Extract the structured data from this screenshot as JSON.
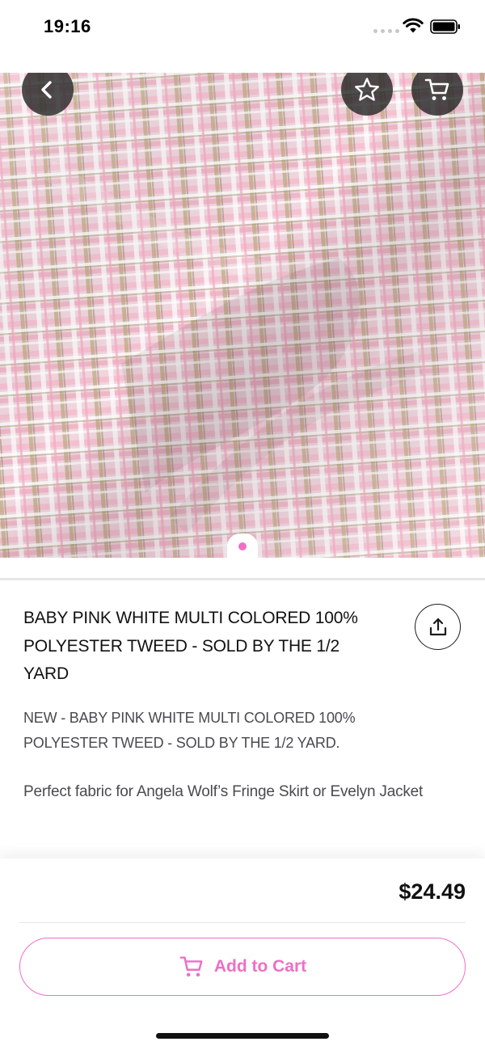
{
  "status_bar": {
    "time": "19:16"
  },
  "product": {
    "title": "BABY PINK WHITE MULTI COLORED 100% POLYESTER TWEED - SOLD BY THE 1/2 YARD",
    "description_line1": "NEW - BABY PINK WHITE MULTI COLORED 100% POLYESTER TWEED - SOLD BY THE 1/2 YARD.",
    "description_line2": "Perfect fabric for Angela Wolf’s Fringe Skirt or Evelyn Jacket",
    "price": "$24.49"
  },
  "actions": {
    "add_to_cart_label": "Add to Cart"
  },
  "icons": {
    "back": "chevron-left-icon",
    "favorite": "star-icon",
    "cart": "cart-icon",
    "share": "share-icon"
  },
  "colors": {
    "accent": "#f06fc7",
    "overlay_button": "#282828",
    "fabric_pink": "#f4c6d4",
    "fabric_gold": "#a89a6a"
  },
  "carousel": {
    "image_count": 1,
    "active_index": 0
  }
}
